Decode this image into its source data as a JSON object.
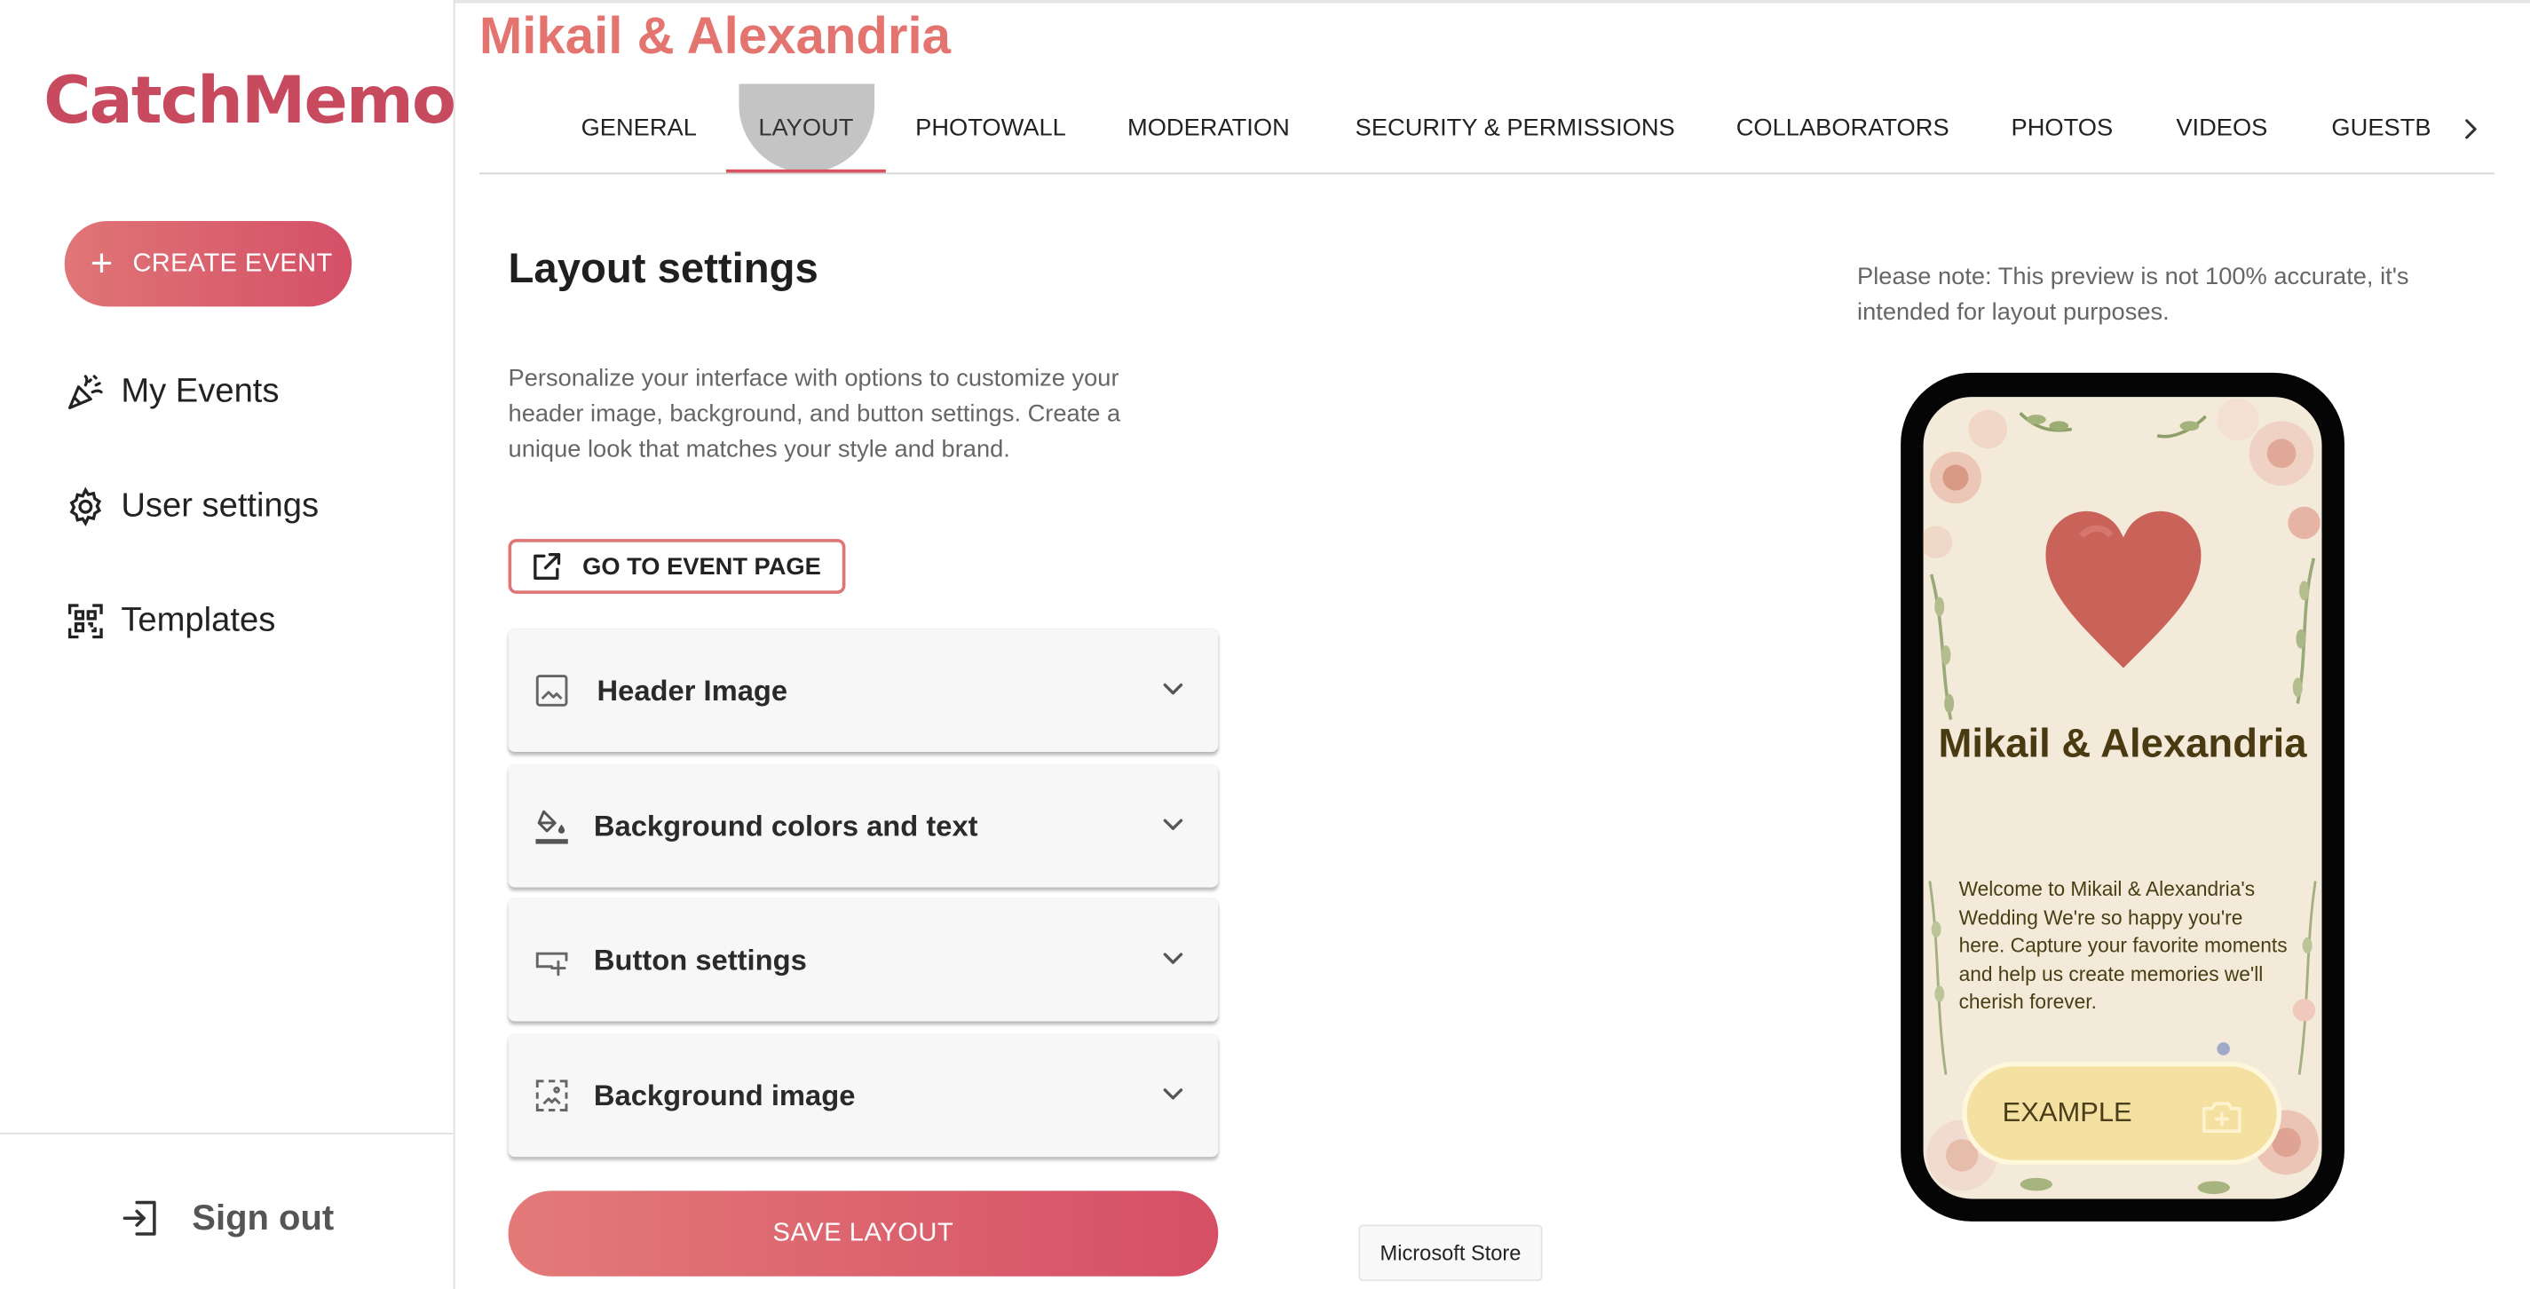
{
  "sidebar": {
    "logo": "CatchMemo",
    "create_event_label": "CREATE EVENT",
    "nav": {
      "events": "My Events",
      "settings": "User settings",
      "templates": "Templates"
    },
    "sign_out": "Sign out"
  },
  "header": {
    "event_title": "Mikail & Alexandria",
    "tabs": [
      "GENERAL",
      "LAYOUT",
      "PHOTOWALL",
      "MODERATION",
      "SECURITY & PERMISSIONS",
      "COLLABORATORS",
      "PHOTOS",
      "VIDEOS",
      "GUESTB"
    ],
    "active_tab": "LAYOUT"
  },
  "main": {
    "heading": "Layout settings",
    "description": "Personalize your interface with options to customize your header image, background, and button settings. Create a unique look that matches your style and brand.",
    "go_to_event_label": "GO TO EVENT PAGE",
    "accordions": [
      {
        "title": "Header Image",
        "icon": "image-icon"
      },
      {
        "title": "Background colors and text",
        "icon": "paint-bucket-icon"
      },
      {
        "title": "Button settings",
        "icon": "button-icon"
      },
      {
        "title": "Background image",
        "icon": "background-image-icon"
      }
    ],
    "save_label": "SAVE LAYOUT"
  },
  "tooltip": "Microsoft Store",
  "preview": {
    "note": "Please note: This preview is not 100% accurate, it's intended for layout purposes.",
    "title": "Mikail & Alexandria",
    "welcome": "Welcome to Mikail & Alexandria's Wedding We're so happy you're here. Capture your favorite moments and help us create memories we'll cherish forever.",
    "button_label": "EXAMPLE"
  },
  "colors": {
    "brand": "#c84a5e",
    "accent_gradient_start": "#e07576",
    "accent_gradient_end": "#d45067",
    "title_coral": "#e4746f",
    "preview_button": "#f4e0a0"
  }
}
